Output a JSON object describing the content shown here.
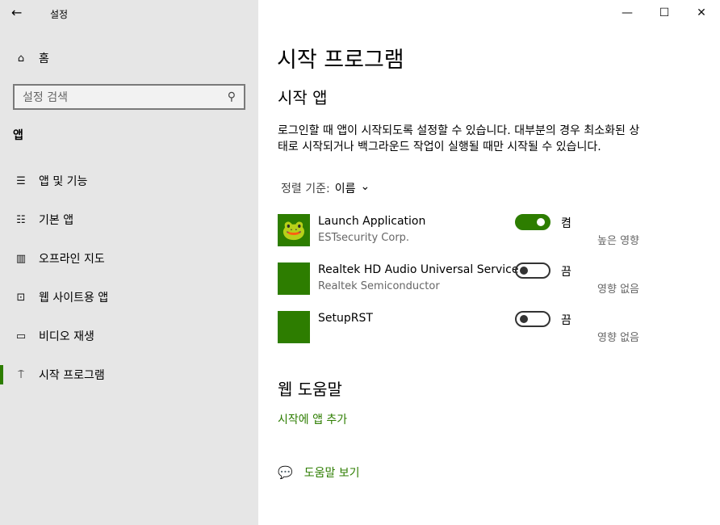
{
  "window": {
    "title": "설정",
    "minimize": "—",
    "maximize": "☐",
    "close": "✕"
  },
  "sidebar": {
    "home": "홈",
    "search_placeholder": "설정 검색",
    "section": "앱",
    "items": [
      {
        "label": "앱 및 기능",
        "icon": "list-icon"
      },
      {
        "label": "기본 앱",
        "icon": "default-apps-icon"
      },
      {
        "label": "오프라인 지도",
        "icon": "map-icon"
      },
      {
        "label": "웹 사이트용 앱",
        "icon": "web-app-icon"
      },
      {
        "label": "비디오 재생",
        "icon": "video-icon"
      },
      {
        "label": "시작 프로그램",
        "icon": "startup-icon",
        "selected": true
      }
    ]
  },
  "main": {
    "title": "시작 프로그램",
    "subtitle": "시작 앱",
    "description": "로그인할 때 앱이 시작되도록 설정할 수 있습니다. 대부분의 경우 최소화된 상태로 시작되거나 백그라운드 작업이 실행될 때만 시작될 수 있습니다.",
    "sort_label": "정렬 기준:",
    "sort_value": "이름",
    "apps": [
      {
        "name": "Launch Application",
        "publisher": "ESTsecurity Corp.",
        "enabled": true,
        "status": "켬",
        "impact": "높은 영향"
      },
      {
        "name": "Realtek HD Audio Universal Service",
        "publisher": "Realtek Semiconductor",
        "enabled": false,
        "status": "끔",
        "impact": "영향 없음"
      },
      {
        "name": "SetupRST",
        "publisher": "",
        "enabled": false,
        "status": "끔",
        "impact": "영향 없음"
      }
    ],
    "web_help_title": "웹 도움말",
    "web_help_link": "시작에 앱 추가",
    "help_link": "도움말 보기"
  },
  "colors": {
    "accent": "#2d7d00",
    "sidebar_bg": "#e6e6e6"
  }
}
